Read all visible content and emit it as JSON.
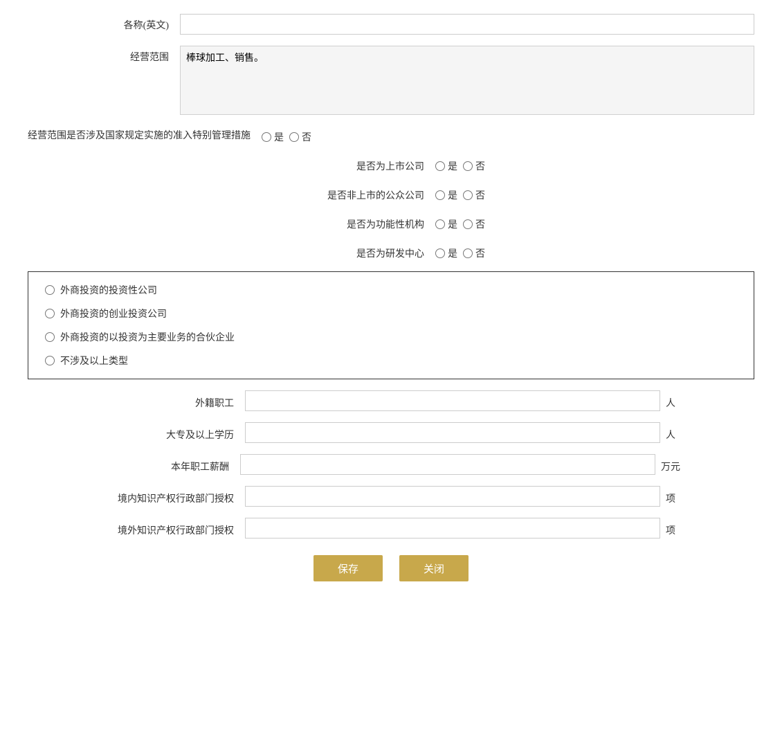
{
  "form": {
    "name_en_label": "各称(英文)",
    "name_en_value": "",
    "business_scope_label": "经营范围",
    "business_scope_value": "棒球加工、销售。",
    "special_management_label": "经营范围是否涉及国家规定实施的准入特别管理措施",
    "is_label": "是",
    "no_label": "否",
    "listed_company_label": "是否为上市公司",
    "non_listed_public_label": "是否非上市的公众公司",
    "functional_org_label": "是否为功能性机构",
    "rnd_center_label": "是否为研发中心",
    "investment_options": [
      "外商投资的投资性公司",
      "外商投资的创业投资公司",
      "外商投资的以投资为主要业务的合伙企业",
      "不涉及以上类型"
    ],
    "foreign_workers_label": "外籍职工",
    "foreign_workers_unit": "人",
    "foreign_workers_value": "",
    "college_degree_label": "大专及以上学历",
    "college_degree_unit": "人",
    "college_degree_value": "",
    "annual_salary_label": "本年职工薪酬",
    "annual_salary_unit": "万元",
    "annual_salary_value": "",
    "domestic_ip_label": "境内知识产权行政部门授权",
    "domestic_ip_unit": "项",
    "domestic_ip_value": "",
    "foreign_ip_label": "境外知识产权行政部门授权",
    "foreign_ip_unit": "项",
    "foreign_ip_value": "",
    "save_button": "保存",
    "close_button": "关闭"
  }
}
